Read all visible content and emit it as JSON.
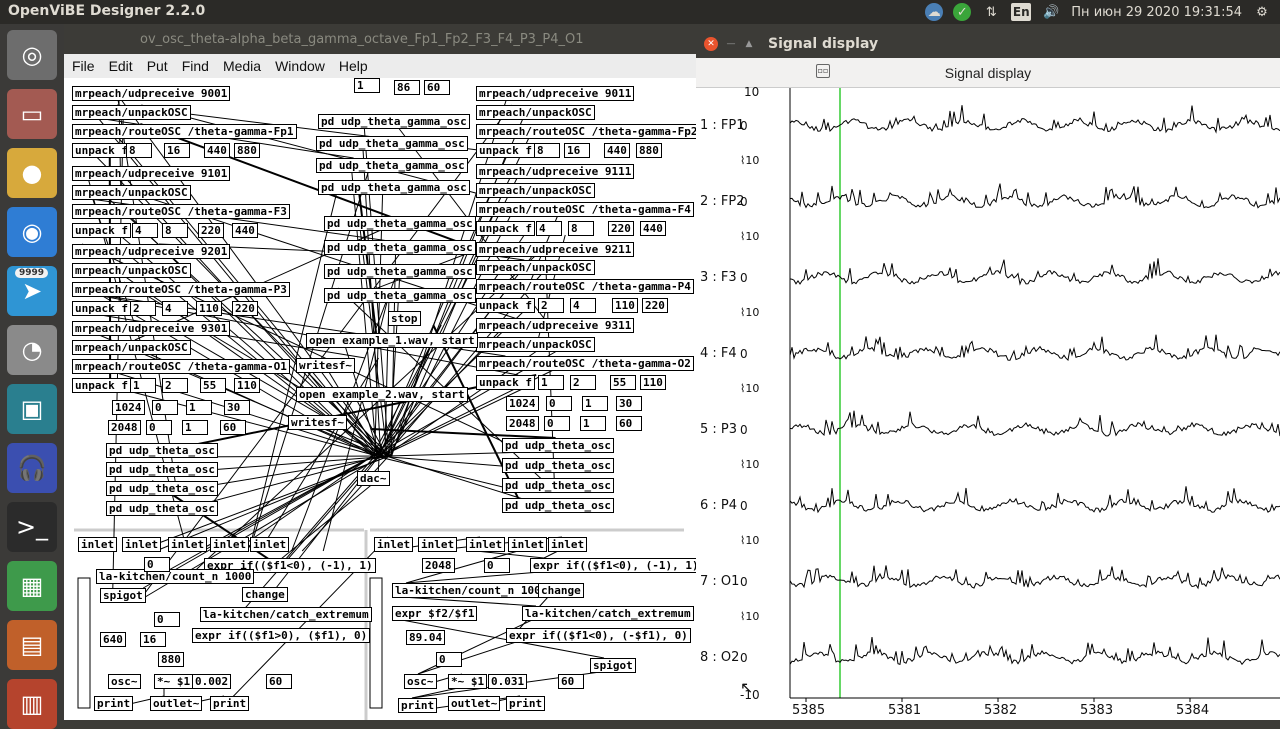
{
  "topbar": {
    "app_title": "OpenViBE Designer 2.2.0",
    "language": "En",
    "datetime": "Пн июн 29 2020 19:31:54",
    "icons": [
      "cloud-icon",
      "shield-check-icon",
      "network-arrows-icon",
      "language-icon",
      "volume-icon",
      "settings-gear-icon"
    ]
  },
  "launcher": {
    "items": [
      {
        "name": "ubuntu-dash-icon",
        "color": "#6d6d6d",
        "glyph": "◎"
      },
      {
        "name": "files-icon",
        "color": "#a35a52",
        "glyph": "▭"
      },
      {
        "name": "chrome-icon",
        "color": "#d7a93c",
        "glyph": "●"
      },
      {
        "name": "chromium-icon",
        "color": "#2f7dd4",
        "glyph": "◉"
      },
      {
        "name": "telegram-icon",
        "color": "#2f95d4",
        "glyph": "➤",
        "badge": "9999"
      },
      {
        "name": "disk-icon",
        "color": "#8a8a8a",
        "glyph": "◔"
      },
      {
        "name": "presentation-icon",
        "color": "#2a7f8f",
        "glyph": "▣"
      },
      {
        "name": "audacity-icon",
        "color": "#3b4fb0",
        "glyph": "🎧"
      },
      {
        "name": "terminal-icon",
        "color": "#2b2b2b",
        "glyph": ">_"
      },
      {
        "name": "spreadsheet-icon",
        "color": "#3e9a4b",
        "glyph": "▦"
      },
      {
        "name": "impress-icon",
        "color": "#c0602a",
        "glyph": "▤"
      },
      {
        "name": "writer-icon",
        "color": "#b5442d",
        "glyph": "▥"
      }
    ]
  },
  "pd_window": {
    "title": "ov_osc_theta-alpha_beta_gamma_octave_Fp1_Fp2_F3_F4_P3_P4_O1",
    "menu": [
      "File",
      "Edit",
      "Put",
      "Find",
      "Media",
      "Window",
      "Help"
    ],
    "objects": [
      [
        "mrpeach/udpreceive 9001",
        8,
        8
      ],
      [
        "mrpeach/unpackOSC",
        8,
        27
      ],
      [
        "mrpeach/routeOSC /theta-gamma-Fp1",
        8,
        46
      ],
      [
        "unpack f",
        8,
        65
      ],
      [
        "mrpeach/udpreceive 9101",
        8,
        88
      ],
      [
        "mrpeach/unpackOSC",
        8,
        107
      ],
      [
        "mrpeach/routeOSC /theta-gamma-F3",
        8,
        126
      ],
      [
        "unpack f",
        8,
        145
      ],
      [
        "mrpeach/udpreceive 9201",
        8,
        166
      ],
      [
        "mrpeach/unpackOSC",
        8,
        185
      ],
      [
        "mrpeach/routeOSC /theta-gamma-P3",
        8,
        204
      ],
      [
        "unpack f",
        8,
        223
      ],
      [
        "mrpeach/udpreceive 9301",
        8,
        243
      ],
      [
        "mrpeach/unpackOSC",
        8,
        262
      ],
      [
        "mrpeach/routeOSC /theta-gamma-O1",
        8,
        281
      ],
      [
        "unpack f",
        8,
        300
      ],
      [
        "mrpeach/udpreceive 9011",
        412,
        8
      ],
      [
        "mrpeach/unpackOSC",
        412,
        27
      ],
      [
        "mrpeach/routeOSC /theta-gamma-Fp2",
        412,
        46
      ],
      [
        "unpack f",
        412,
        65
      ],
      [
        "mrpeach/udpreceive 9111",
        412,
        86
      ],
      [
        "mrpeach/unpackOSC",
        412,
        105
      ],
      [
        "mrpeach/routeOSC /theta-gamma-F4",
        412,
        124
      ],
      [
        "unpack f",
        412,
        143
      ],
      [
        "mrpeach/udpreceive 9211",
        412,
        164
      ],
      [
        "mrpeach/unpackOSC",
        412,
        182
      ],
      [
        "mrpeach/routeOSC /theta-gamma-P4",
        412,
        201
      ],
      [
        "unpack f",
        412,
        220
      ],
      [
        "mrpeach/udpreceive 9311",
        412,
        240
      ],
      [
        "mrpeach/unpackOSC",
        412,
        259
      ],
      [
        "mrpeach/routeOSC /theta-gamma-O2",
        412,
        278
      ],
      [
        "unpack f",
        412,
        297
      ],
      [
        "pd udp_theta_gamma_osc",
        254,
        36
      ],
      [
        "pd udp_theta_gamma_osc",
        252,
        58
      ],
      [
        "pd udp_theta_gamma_osc",
        252,
        80
      ],
      [
        "pd udp_theta_gamma_osc",
        254,
        102
      ],
      [
        "pd udp_theta_gamma_osc",
        260,
        138
      ],
      [
        "pd udp_theta_gamma_osc",
        260,
        162
      ],
      [
        "pd udp_theta_gamma_osc",
        260,
        186
      ],
      [
        "pd udp_theta_gamma_osc",
        260,
        210
      ],
      [
        "stop",
        324,
        233
      ],
      [
        "open example_1.wav, start",
        242,
        255
      ],
      [
        "writesf~",
        232,
        280
      ],
      [
        "open example_2.wav, start",
        232,
        309
      ],
      [
        "writesf~",
        224,
        337
      ],
      [
        "dac~",
        293,
        393
      ],
      [
        "pd udp_theta_osc",
        42,
        365
      ],
      [
        "pd udp_theta_osc",
        42,
        384
      ],
      [
        "pd udp_theta_osc",
        42,
        403
      ],
      [
        "pd udp_theta_osc",
        42,
        423
      ],
      [
        "pd udp_theta_osc",
        438,
        360
      ],
      [
        "pd udp_theta_osc",
        438,
        380
      ],
      [
        "pd udp_theta_osc",
        438,
        400
      ],
      [
        "pd udp_theta_osc",
        438,
        420
      ],
      [
        "inlet",
        14,
        459
      ],
      [
        "inlet",
        58,
        459
      ],
      [
        "inlet",
        104,
        459
      ],
      [
        "inlet",
        146,
        459
      ],
      [
        "inlet",
        186,
        459
      ],
      [
        "expr if(($f1<0), (-1), 1)",
        140,
        480
      ],
      [
        "la-kitchen/count_n 1000",
        32,
        491
      ],
      [
        "spigot",
        36,
        510
      ],
      [
        "change",
        178,
        509
      ],
      [
        "la-kitchen/catch_extremum",
        136,
        529
      ],
      [
        "expr if(($f1>0), ($f1), 0)",
        128,
        550
      ],
      [
        "osc~",
        44,
        596
      ],
      [
        "*~ $1",
        90,
        596
      ],
      [
        "print",
        30,
        618
      ],
      [
        "outlet~",
        86,
        618
      ],
      [
        "print",
        146,
        618
      ],
      [
        "inlet",
        310,
        459
      ],
      [
        "inlet",
        354,
        459
      ],
      [
        "inlet",
        402,
        459
      ],
      [
        "inlet",
        444,
        459
      ],
      [
        "inlet",
        484,
        459
      ],
      [
        "expr if(($f1<0), (-1), 1)",
        466,
        480
      ],
      [
        "la-kitchen/count_n 1000",
        328,
        505
      ],
      [
        "change",
        474,
        505
      ],
      [
        "expr $f2/$f1",
        328,
        528
      ],
      [
        "la-kitchen/catch_extremum",
        458,
        528
      ],
      [
        "expr if(($f1<0), (-$f1), 0)",
        442,
        550
      ],
      [
        "spigot",
        526,
        580
      ],
      [
        "osc~",
        340,
        596
      ],
      [
        "*~ $1",
        384,
        596
      ],
      [
        "print",
        334,
        620
      ],
      [
        "outlet~",
        384,
        618
      ],
      [
        "print",
        442,
        618
      ]
    ],
    "numbers": [
      [
        "1",
        290,
        0
      ],
      [
        "86",
        330,
        2
      ],
      [
        "60",
        360,
        2
      ],
      [
        "8",
        62,
        65
      ],
      [
        "16",
        100,
        65
      ],
      [
        "440",
        140,
        65
      ],
      [
        "880",
        170,
        65
      ],
      [
        "4",
        68,
        145
      ],
      [
        "8",
        98,
        145
      ],
      [
        "220",
        134,
        145
      ],
      [
        "440",
        168,
        145
      ],
      [
        "2",
        66,
        223
      ],
      [
        "4",
        98,
        223
      ],
      [
        "110",
        132,
        223
      ],
      [
        "220",
        168,
        223
      ],
      [
        "1",
        66,
        300
      ],
      [
        "2",
        98,
        300
      ],
      [
        "55",
        136,
        300
      ],
      [
        "110",
        170,
        300
      ],
      [
        "8",
        470,
        65
      ],
      [
        "16",
        500,
        65
      ],
      [
        "440",
        540,
        65
      ],
      [
        "880",
        572,
        65
      ],
      [
        "4",
        472,
        143
      ],
      [
        "8",
        504,
        143
      ],
      [
        "220",
        544,
        143
      ],
      [
        "440",
        576,
        143
      ],
      [
        "2",
        474,
        220
      ],
      [
        "4",
        506,
        220
      ],
      [
        "110",
        548,
        220
      ],
      [
        "220",
        578,
        220
      ],
      [
        "1",
        474,
        297
      ],
      [
        "2",
        506,
        297
      ],
      [
        "55",
        546,
        297
      ],
      [
        "110",
        576,
        297
      ],
      [
        "1024",
        48,
        322
      ],
      [
        "0",
        88,
        322
      ],
      [
        "1",
        122,
        322
      ],
      [
        "30",
        160,
        322
      ],
      [
        "2048",
        44,
        342
      ],
      [
        "0",
        82,
        342
      ],
      [
        "1",
        118,
        342
      ],
      [
        "60",
        156,
        342
      ],
      [
        "1024",
        442,
        318
      ],
      [
        "0",
        482,
        318
      ],
      [
        "1",
        518,
        318
      ],
      [
        "30",
        552,
        318
      ],
      [
        "2048",
        442,
        338
      ],
      [
        "0",
        480,
        338
      ],
      [
        "1",
        516,
        338
      ],
      [
        "60",
        552,
        338
      ],
      [
        "0",
        80,
        479
      ],
      [
        "0",
        90,
        534
      ],
      [
        "640",
        36,
        554
      ],
      [
        "16",
        76,
        554
      ],
      [
        "880",
        94,
        574
      ],
      [
        "0.002",
        128,
        596
      ],
      [
        "60",
        202,
        596
      ],
      [
        "2048",
        358,
        480
      ],
      [
        "0",
        420,
        480
      ],
      [
        "89.04",
        342,
        552
      ],
      [
        "0",
        372,
        574
      ],
      [
        "0.031",
        424,
        596
      ],
      [
        "60",
        494,
        596
      ]
    ]
  },
  "signal_window": {
    "title": "Signal display",
    "toolbar_title": "Signal display",
    "accent_color": "#33cc33",
    "channels": [
      {
        "label": "1 : FP1",
        "zero": "0"
      },
      {
        "label": "2 : FP2",
        "zero": "0"
      },
      {
        "label": "3 : F3",
        "zero": "0"
      },
      {
        "label": "4 : F4",
        "zero": "0"
      },
      {
        "label": "5 : P3",
        "zero": "0"
      },
      {
        "label": "6 : P4",
        "zero": "0"
      },
      {
        "label": "7 : O1",
        "zero": "0"
      },
      {
        "label": "8 : O2",
        "zero": "0"
      }
    ],
    "top_tick": "10",
    "bottom_tick": "-10",
    "scale_tick": "10",
    "x_ticks": [
      "5385",
      "5381",
      "5382",
      "5383",
      "5384"
    ]
  }
}
